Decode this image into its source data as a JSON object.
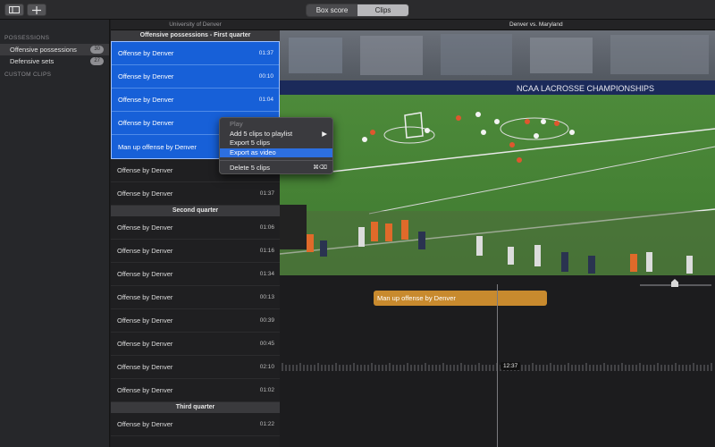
{
  "toolbar": {
    "segments": [
      {
        "label": "Box score",
        "active": false
      },
      {
        "label": "Clips",
        "active": true
      }
    ]
  },
  "sidebar": {
    "possessions_header": "POSSESSIONS",
    "items": [
      {
        "label": "Offensive possessions",
        "count": "30"
      },
      {
        "label": "Defensive sets",
        "count": "27"
      }
    ],
    "custom_header": "CUSTOM CLIPS"
  },
  "columns": {
    "left": "University of Denver",
    "right": "Denver vs. Maryland"
  },
  "list": {
    "section1": "Offensive possessions - First quarter",
    "rows1": [
      {
        "title": "Offense by Denver",
        "time": "01:37"
      },
      {
        "title": "Offense by Denver",
        "time": "00:10"
      },
      {
        "title": "Offense by Denver",
        "time": "01:04"
      },
      {
        "title": "Offense by Denver",
        "time": ""
      },
      {
        "title": "Man up offense by Denver",
        "time": ""
      },
      {
        "title": "Offense by Denver",
        "time": ""
      },
      {
        "title": "Offense by Denver",
        "time": "01:37"
      }
    ],
    "section2": "Second quarter",
    "rows2": [
      {
        "title": "Offense by Denver",
        "time": "01:06"
      },
      {
        "title": "Offense by Denver",
        "time": "01:16"
      },
      {
        "title": "Offense by Denver",
        "time": "01:34"
      },
      {
        "title": "Offense by Denver",
        "time": "00:13"
      },
      {
        "title": "Offense by Denver",
        "time": "00:39"
      },
      {
        "title": "Offense by Denver",
        "time": "00:45"
      },
      {
        "title": "Offense by Denver",
        "time": "02:10"
      },
      {
        "title": "Offense by Denver",
        "time": "01:02"
      }
    ],
    "section3": "Third quarter",
    "rows3": [
      {
        "title": "Offense by Denver",
        "time": "01:22"
      }
    ]
  },
  "video": {
    "banner_text": "NCAA LACROSSE CHAMPIONSHIPS"
  },
  "timeline": {
    "clip_label": "Man up offense by Denver",
    "timecode": "12:37"
  },
  "context_menu": {
    "items": [
      {
        "label": "Play",
        "disabled": true
      },
      {
        "label": "Add 5 clips to playlist",
        "submenu": true
      },
      {
        "label": "Export 5 clips"
      },
      {
        "label": "Export as video",
        "highlighted": true
      },
      {
        "label": "Delete 5 clips",
        "shortcut": "⌘⌫"
      }
    ]
  },
  "colors": {
    "selection": "#1760d8",
    "clip_bar": "#c88a2e",
    "menu_highlight": "#2d6fe0"
  }
}
